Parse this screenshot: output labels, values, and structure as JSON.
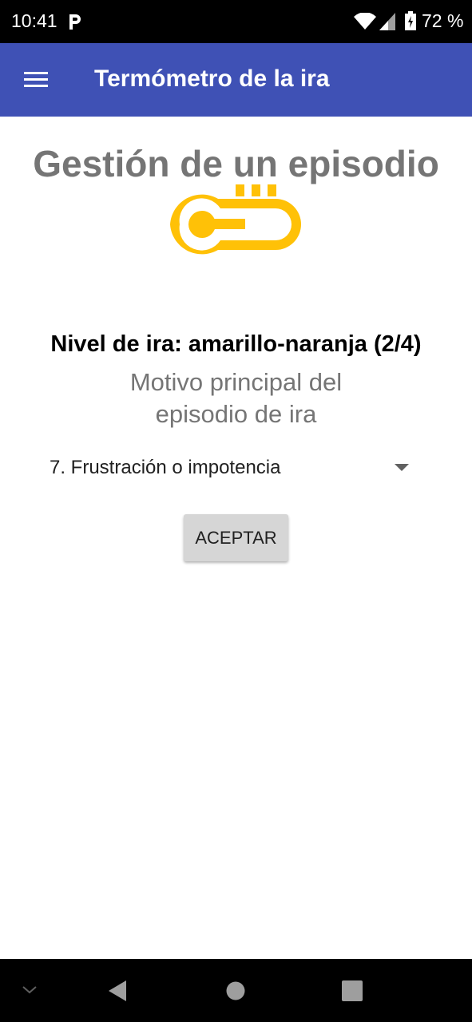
{
  "status_bar": {
    "time": "10:41",
    "battery_percent": "72 %",
    "icons": [
      "parking-notification-icon",
      "wifi-icon",
      "signal-icon",
      "battery-charging-icon"
    ]
  },
  "app_bar": {
    "title": "Termómetro de la ira",
    "menu_icon": "hamburger-menu-icon",
    "background_color": "#3f51b5"
  },
  "main": {
    "title": "Gestión de un episodio",
    "thermometer_icon": "thermometer-icon",
    "thermometer_color": "#ffc107",
    "level_text": "Nivel de ira: amarillo-naranja (2/4)",
    "reason_label_line1": "Motivo principal del",
    "reason_label_line2": "episodio de ira",
    "reason_selected": "7. Frustración o impotencia",
    "accept_label": "ACEPTAR"
  },
  "nav_bar": {
    "icons": [
      "hide-keyboard-icon",
      "back-icon",
      "home-icon",
      "recents-icon"
    ]
  }
}
